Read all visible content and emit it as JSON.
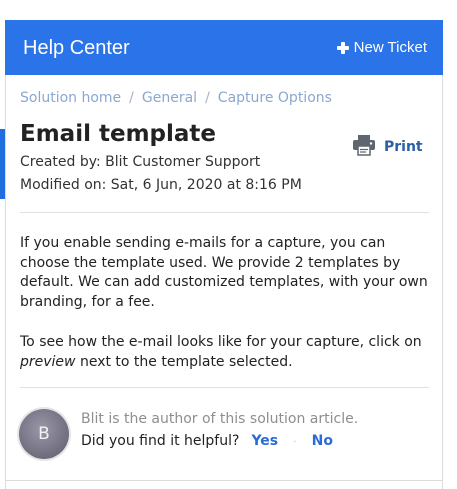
{
  "header": {
    "title": "Help Center",
    "new_ticket_label": "New Ticket"
  },
  "breadcrumb": {
    "items": [
      "Solution home",
      "General",
      "Capture Options"
    ],
    "separator": "/"
  },
  "article": {
    "title": "Email template",
    "created_by": "Created by: Blit Customer Support",
    "modified_on": "Modified on: Sat, 6 Jun, 2020 at 8:16 PM",
    "print_label": "Print",
    "paragraph_1": "If you enable sending e-mails for a capture, you can choose the template used. We provide 2 templates by default. We can add customized templates, with your own branding, for a fee.",
    "paragraph_2_before": "To see how the e-mail looks like for your capture, click on ",
    "paragraph_2_em": "preview",
    "paragraph_2_after": " next to the template selected."
  },
  "feedback": {
    "avatar_initial": "B",
    "author_note": "Blit is the author of this solution article.",
    "question": "Did you find it helpful?",
    "yes_label": "Yes",
    "separator": "·",
    "no_label": "No"
  },
  "icons": {
    "new_ticket": "plus-icon",
    "print": "printer-icon"
  },
  "colors": {
    "header_bg": "#2a73e8",
    "link": "#2a6cd6",
    "breadcrumb": "#8aa8cf"
  }
}
